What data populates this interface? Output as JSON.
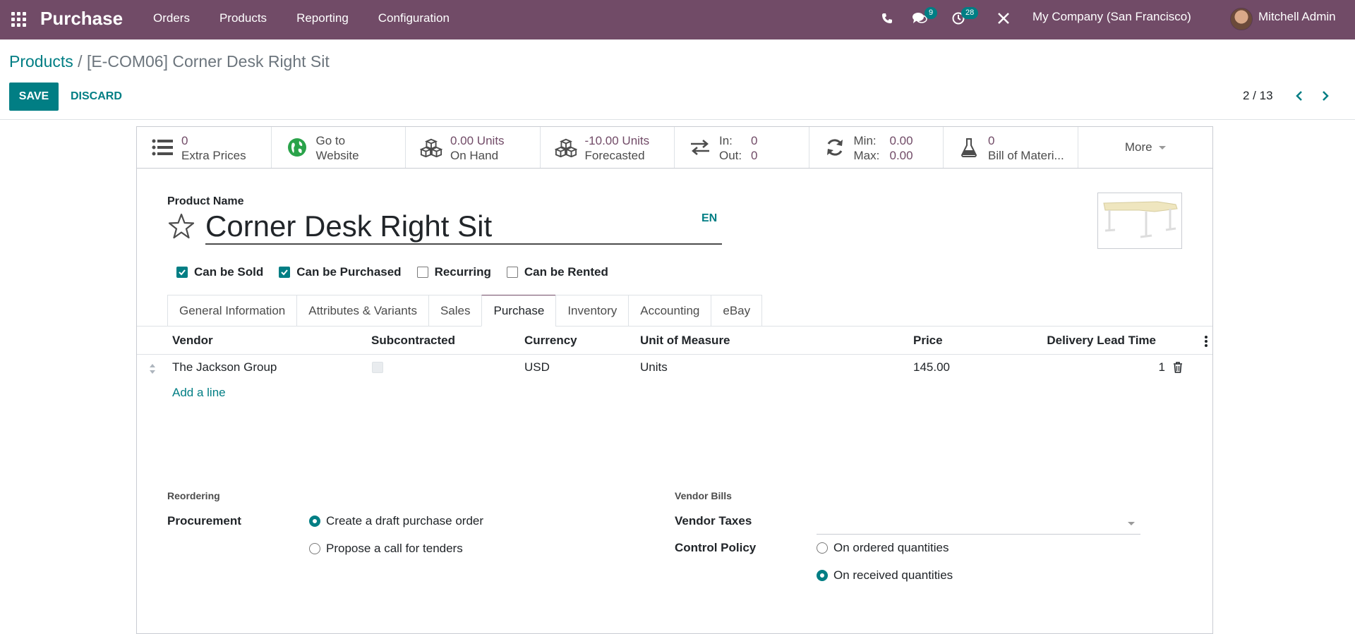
{
  "navbar": {
    "app_name": "Purchase",
    "menu": [
      "Orders",
      "Products",
      "Reporting",
      "Configuration"
    ],
    "messages_badge": "9",
    "activities_badge": "28",
    "company": "My Company (San Francisco)",
    "user": "Mitchell Admin",
    "color": "#714b67"
  },
  "control_panel": {
    "breadcrumb_parent": "Products",
    "breadcrumb_sep": " / ",
    "breadcrumb_current": "[E-COM06] Corner Desk Right Sit",
    "save_label": "SAVE",
    "discard_label": "DISCARD",
    "pager": "2 / 13"
  },
  "stat_buttons": [
    {
      "icon": "list-icon",
      "line1": "0",
      "line2": "Extra Prices"
    },
    {
      "icon": "globe-icon",
      "line1": "Go to",
      "line2": "Website"
    },
    {
      "icon": "cubes-icon",
      "line1": "0.00 Units",
      "line2": "On Hand"
    },
    {
      "icon": "cubes-icon",
      "line1": "-10.00 Units",
      "line2": "Forecasted"
    },
    {
      "icon": "exchange-icon",
      "in_label": "In:",
      "in_value": "0",
      "out_label": "Out:",
      "out_value": "0"
    },
    {
      "icon": "refresh-icon",
      "min_label": "Min:",
      "min_value": "0.00",
      "max_label": "Max:",
      "max_value": "0.00"
    },
    {
      "icon": "flask-icon",
      "line1": "0",
      "line2": "Bill of Materi..."
    },
    {
      "label": "More"
    }
  ],
  "product": {
    "name_label": "Product Name",
    "name": "Corner Desk Right Sit",
    "lang": "EN"
  },
  "options": [
    {
      "label": "Can be Sold",
      "checked": true
    },
    {
      "label": "Can be Purchased",
      "checked": true
    },
    {
      "label": "Recurring",
      "checked": false
    },
    {
      "label": "Can be Rented",
      "checked": false
    }
  ],
  "tabs": [
    "General Information",
    "Attributes & Variants",
    "Sales",
    "Purchase",
    "Inventory",
    "Accounting",
    "eBay"
  ],
  "active_tab": "Purchase",
  "vendor_table": {
    "columns": [
      "Vendor",
      "Subcontracted",
      "Currency",
      "Unit of Measure",
      "Price",
      "Delivery Lead Time"
    ],
    "rows": [
      {
        "vendor": "The Jackson Group",
        "subcontracted": false,
        "currency": "USD",
        "uom": "Units",
        "price": "145.00",
        "lead_time": "1"
      }
    ],
    "add_line": "Add a line"
  },
  "reordering": {
    "section": "Reordering",
    "procurement_label": "Procurement",
    "options": [
      "Create a draft purchase order",
      "Propose a call for tenders"
    ],
    "selected": 0
  },
  "vendor_bills": {
    "section": "Vendor Bills",
    "taxes_label": "Vendor Taxes",
    "control_label": "Control Policy",
    "options": [
      "On ordered quantities",
      "On received quantities"
    ],
    "selected": 1
  }
}
